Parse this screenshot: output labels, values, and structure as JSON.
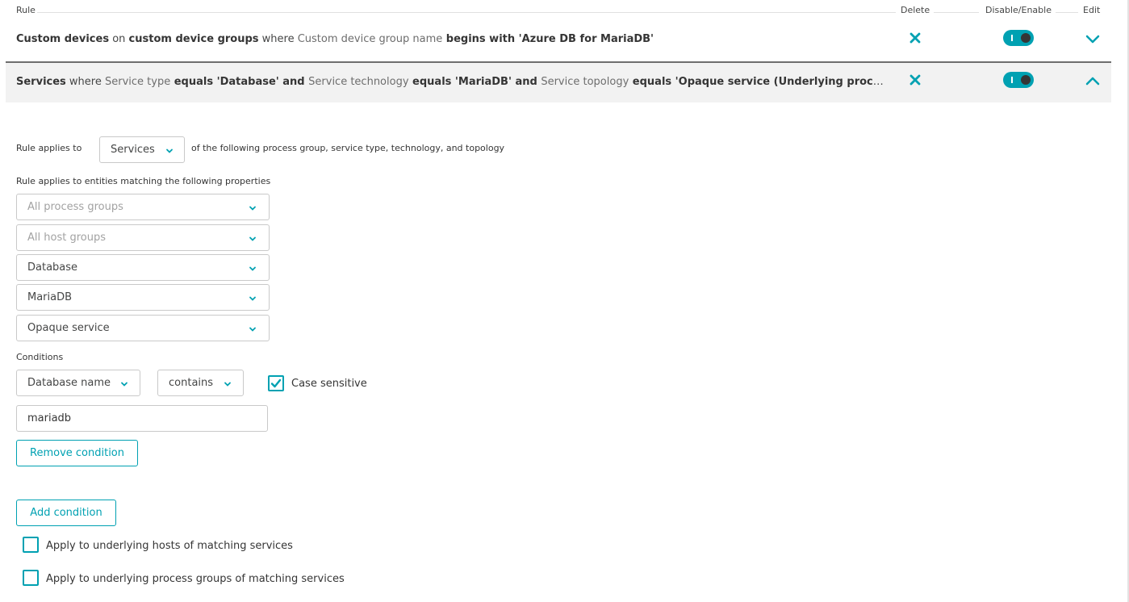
{
  "table_header": {
    "rule": "Rule",
    "delete": "Delete",
    "disable_enable": "Disable/Enable",
    "edit": "Edit"
  },
  "rules": [
    {
      "segments": [
        {
          "t": "Custom devices",
          "s": "b"
        },
        {
          "t": " on ",
          "s": "n"
        },
        {
          "t": "custom device groups",
          "s": "b"
        },
        {
          "t": " where ",
          "s": "n"
        },
        {
          "t": "Custom device group name",
          "s": "l"
        },
        {
          "t": " begins with 'Azure DB for MariaDB'",
          "s": "m"
        }
      ],
      "enabled": true,
      "expanded": false
    },
    {
      "segments": [
        {
          "t": "Services",
          "s": "b"
        },
        {
          "t": " where ",
          "s": "n"
        },
        {
          "t": "Service type",
          "s": "l"
        },
        {
          "t": " equals 'Database' and ",
          "s": "m"
        },
        {
          "t": "Service technology",
          "s": "l"
        },
        {
          "t": " equals 'MariaDB' and ",
          "s": "m"
        },
        {
          "t": "Service topology",
          "s": "l"
        },
        {
          "t": " equals 'Opaque service (Underlying process/host is d…",
          "s": "m"
        }
      ],
      "enabled": true,
      "expanded": true
    }
  ],
  "editor": {
    "applies_to_label": "Rule applies to",
    "applies_to_value": "Services",
    "applies_to_suffix": "of the following process group, service type, technology, and topology",
    "properties_label": "Rule applies to entities matching the following properties",
    "process_groups_placeholder": "All process groups",
    "host_groups_placeholder": "All host groups",
    "service_type": "Database",
    "technology": "MariaDB",
    "topology": "Opaque service",
    "conditions_label": "Conditions",
    "condition_key": "Database name",
    "condition_operator": "contains",
    "case_sensitive_label": "Case sensitive",
    "case_sensitive": true,
    "condition_value": "mariadb",
    "remove_condition": "Remove condition",
    "add_condition": "Add condition",
    "apply_hosts_label": "Apply to underlying hosts of matching services",
    "apply_hosts": false,
    "apply_pg_label": "Apply to underlying process groups of matching services",
    "apply_pg": false
  },
  "colors": {
    "accent": "#00a1b2",
    "toggle_knob": "#353535",
    "expanded_row_bg": "#f2f2f2"
  },
  "icons": {
    "delete": "close-icon",
    "collapse": "chevron-up-icon",
    "expand": "chevron-down-icon",
    "dropdown": "chevron-down-icon",
    "checked": "checkmark-icon"
  }
}
